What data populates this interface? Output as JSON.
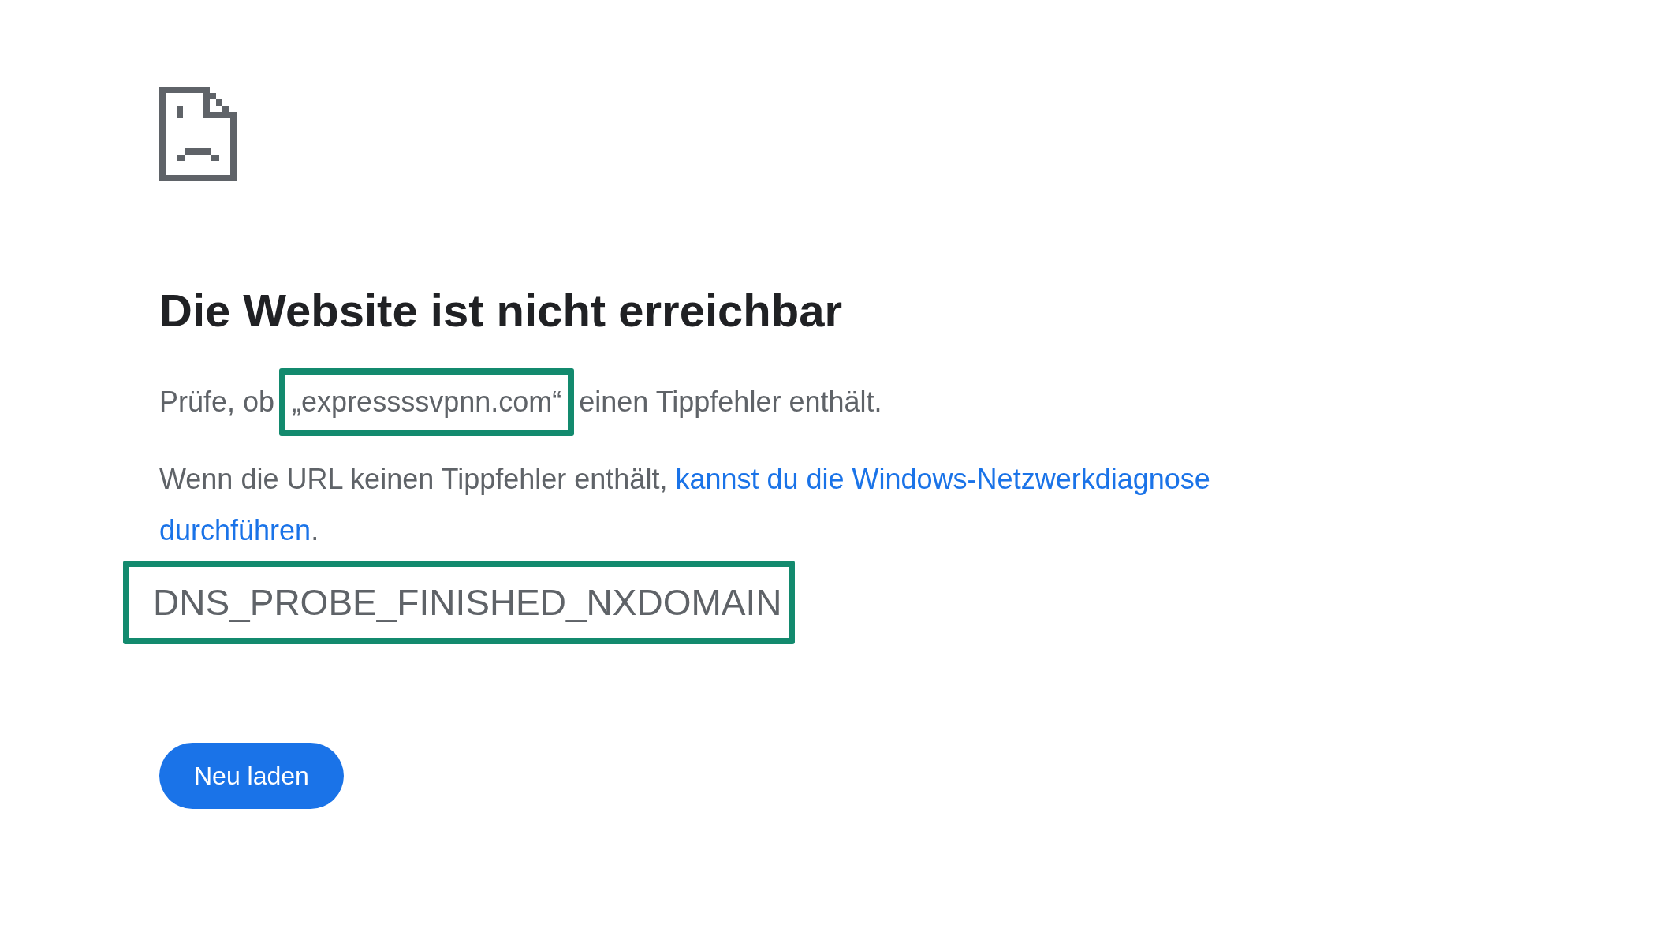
{
  "heading": "Die Website ist nicht erreichbar",
  "check": {
    "before": "Prüfe, ob",
    "domain": "„expressssvpnn.com“",
    "domain_highlighted": true,
    "after": "einen Tippfehler enthält."
  },
  "hint": {
    "text": "Wenn die URL keinen Tippfehler enthält,",
    "link_lines": [
      "kannst du die Windows-Netzwerkdiagnose",
      "durchführen"
    ],
    "after": "."
  },
  "error_code": {
    "text": "DNS_PROBE_FINISHED_NXDOMAIN",
    "highlighted": true
  },
  "buttons": [
    {
      "label": "Neu laden"
    }
  ]
}
